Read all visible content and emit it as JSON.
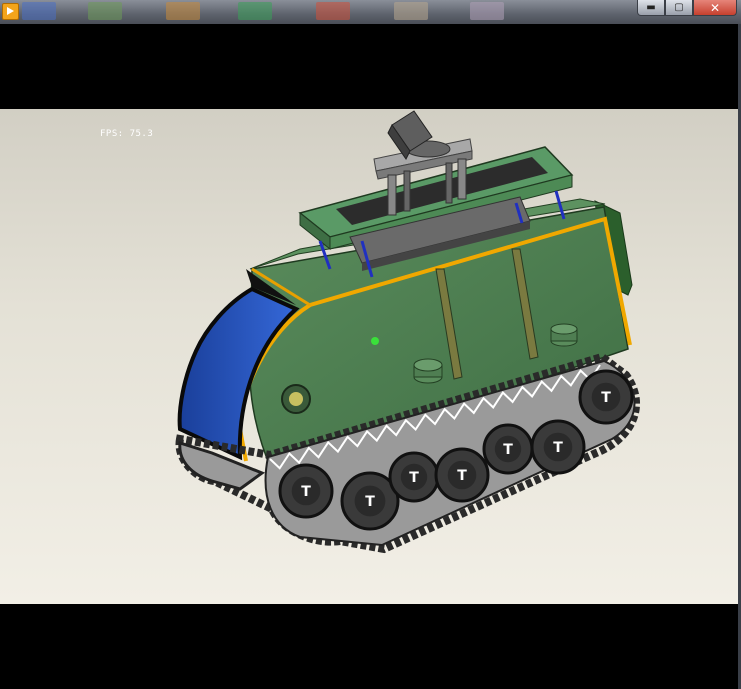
{
  "window": {
    "app_icon": "play-icon",
    "controls": {
      "minimize_icon": "minimize-icon",
      "maximize_icon": "maximize-icon",
      "close_icon": "close-icon",
      "minimize_glyph": "▬",
      "maximize_glyph": "▢",
      "close_glyph": "✕"
    },
    "taskbar_thumbs": [
      "#4a70c4",
      "#6e9a5a",
      "#c98a3a",
      "#3aa05a",
      "#d0503a",
      "#b8a890",
      "#b0a0b8"
    ]
  },
  "viewport": {
    "overlay_text": "FPS: 75.3",
    "background_top": "#d2cfc4",
    "background_bottom": "#f2efe6"
  },
  "model": {
    "name": "tracked-robot",
    "body_color": "#4a7a4e",
    "trim_color": "#f0a800",
    "window_color": "#2456c8",
    "track_color": "#2a2a2a",
    "wheel_color": "#3a3a3a",
    "post_color": "#2030c0",
    "indicator_color": "#3ae03a",
    "wheel_label": "T"
  }
}
